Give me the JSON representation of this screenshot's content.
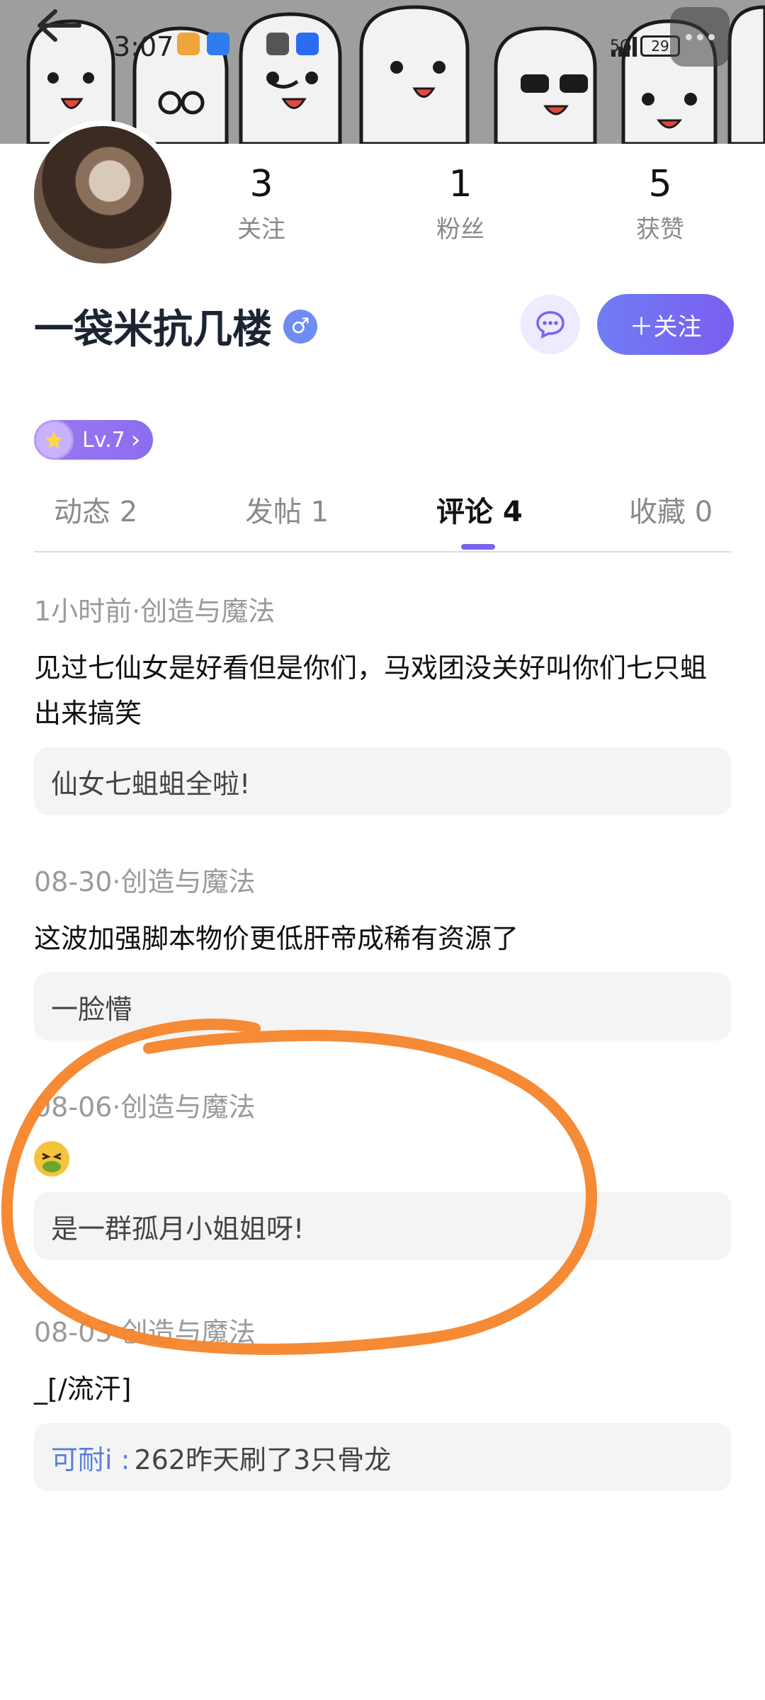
{
  "status_bar": {
    "time": "3:07",
    "network": "5G",
    "battery": "29"
  },
  "profile": {
    "name": "一袋米抗几楼",
    "gender_symbol": "♂",
    "stats": [
      {
        "num": "3",
        "label": "关注"
      },
      {
        "num": "1",
        "label": "粉丝"
      },
      {
        "num": "5",
        "label": "获赞"
      }
    ],
    "follow_label": "＋关注",
    "level_label": "Lv.7",
    "level_arrow": "›"
  },
  "tabs": [
    {
      "label": "动态 2"
    },
    {
      "label": "发帖 1"
    },
    {
      "label": "评论 4",
      "active": true
    },
    {
      "label": "收藏 0"
    }
  ],
  "comments": [
    {
      "meta": "1小时前·创造与魔法",
      "text": "见过七仙女是好看但是你们，马戏团没关好叫你们七只蛆出来搞笑",
      "quote": "仙女七蛆蛆全啦!"
    },
    {
      "meta": "08-30·创造与魔法",
      "text": "这波加强脚本物价更低肝帝成稀有资源了",
      "quote": "一脸懵"
    },
    {
      "meta": "08-06·创造与魔法",
      "text": "",
      "quote": "是一群孤月小姐姐呀!"
    },
    {
      "meta": "08-03·创造与魔法",
      "text": "_[/流汗]",
      "quote_author": "可耐i :",
      "quote": "262昨天刷了3只骨龙"
    }
  ],
  "colors": {
    "accent": "#7b63ee",
    "follow_gradient_start": "#6f7df4",
    "follow_gradient_end": "#7a5ef0",
    "quote_author": "#5b7fd8",
    "scribble": "#f5842a"
  }
}
